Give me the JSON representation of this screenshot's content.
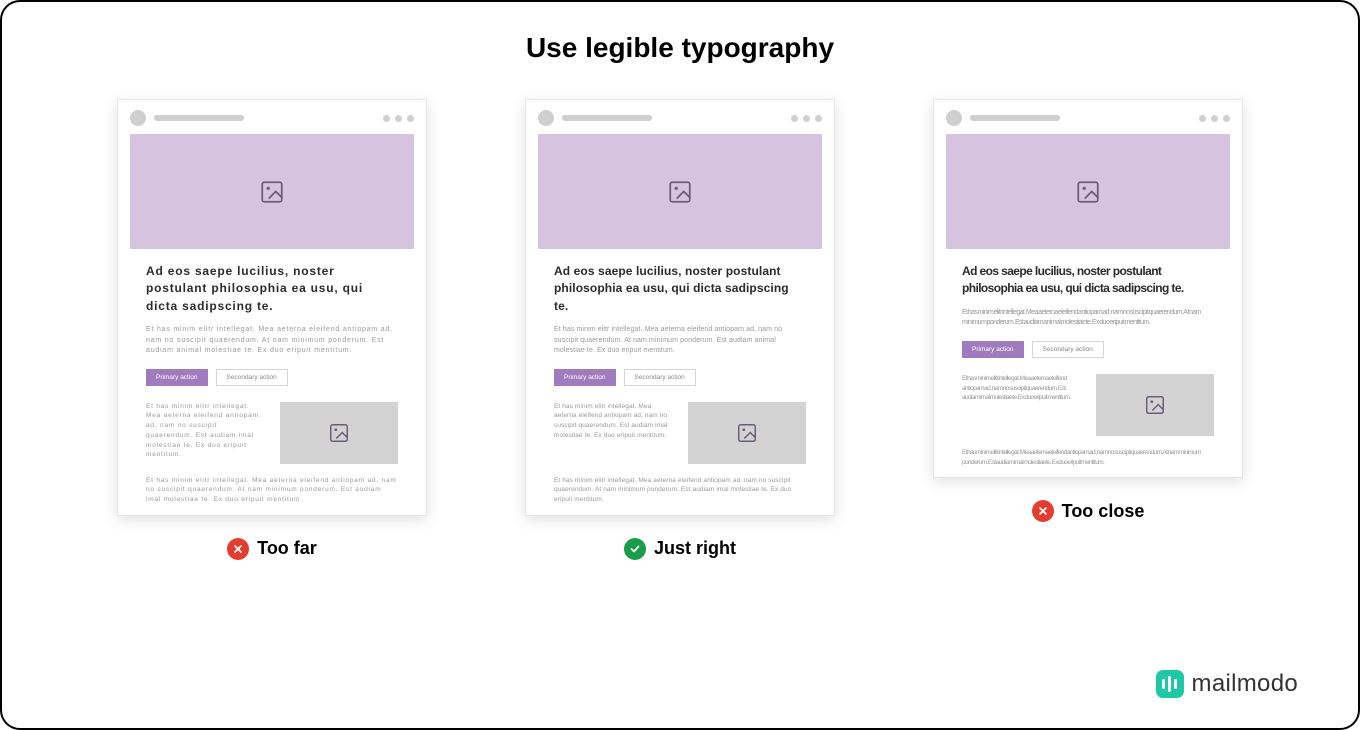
{
  "title": "Use legible typography",
  "examples": [
    {
      "key": "too-far",
      "caption": "Too far",
      "status": "bad",
      "heading": "Ad eos saepe lucilius, noster postulant philosophia ea usu, qui dicta sadipscing te.",
      "body": "Et has minim elitr intellegat. Mea aeterna eleifend antiopam ad, nam no suscipit quaerendum. At nam minimum ponderum. Est audiam animal molestiae te. Ex duo eripuit mentitum.",
      "primary": "Primary action",
      "secondary": "Secondary action",
      "row2": "Et has minim elitr intellegat. Mea aeterna eleifend antiopam ad, nam no suscipit quaerendum. Est audiam imal molestiae te. Ex duo eripuit mentitum.",
      "foot": "Et has minim elitr intellegat. Mea aeterna eleifend antiopam ad, nam no suscipit quaerendum. At nam minimum ponderum. Est audiam imal molestiae te. Ex duo eripuit mentitum."
    },
    {
      "key": "just-right",
      "caption": "Just right",
      "status": "good",
      "heading": "Ad eos saepe lucilius, noster postulant philosophia ea usu, qui dicta sadipscing te.",
      "body": "Et has minim elitr intellegat. Mea aeterna eleifend antiopam ad, nam no suscipit quaerendum. At nam minimum ponderum. Est audiam animal molestiae te. Ex duo eripuit mentitum.",
      "primary": "Primary action",
      "secondary": "Secondary action",
      "row2": "Et has minim elitr intellegat. Mea aeterna eleifend antiopam ad, nam no suscipit quaerendum. Est audiam imal molestiae te. Ex duo eripuit mentitum.",
      "foot": "Et has minim elitr intellegat. Mea aeterna eleifend antiopam ad, nam no suscipit quaerendum. At nam minimum ponderum. Est audiam imal molestiae te. Ex duo eripuit mentitum."
    },
    {
      "key": "too-close",
      "caption": "Too close",
      "status": "bad",
      "heading": "Ad eos saepe lucilius, noster postulant philosophia ea usu, qui dicta sadipscing te.",
      "body": "Et has minim elitr intellegat. Mea aeterna eleifend antiopam ad, nam no suscipit quaerendum. At nam minimum ponderum. Est audiam animal molestiae te. Ex duo eripuit mentitum.",
      "primary": "Primary action",
      "secondary": "Secondary action",
      "row2": "Et has minim elitr intellegat. Mea aeterna eleifend antiopam ad, nam no suscipit quaerendum. Est audiam imal molestiae te. Ex duo eripuit mentitum.",
      "foot": "Et has minim elitr intellegat. Mea aeterna eleifend antiopam ad, nam no suscipit quaerendum. At nam minimum ponderum. Est audiam imal molestiae te. Ex duo eripuit mentitum."
    }
  ],
  "brand": "mailmodo",
  "colors": {
    "hero": "#d5c3e0",
    "primary": "#a07cbf",
    "good": "#1a9d4a",
    "bad": "#e43d30",
    "brand": "#1ec8a5"
  }
}
